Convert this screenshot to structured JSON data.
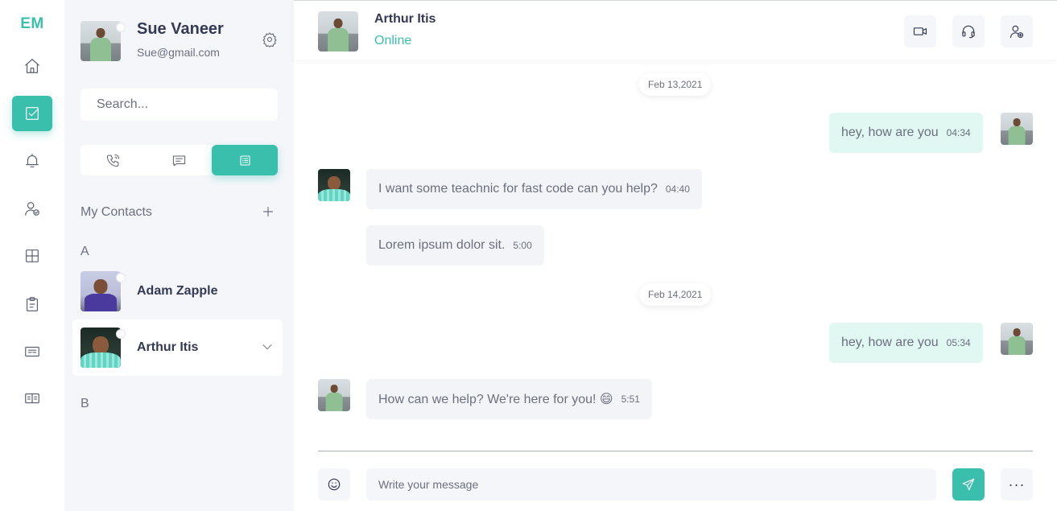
{
  "app": {
    "logo": "EM",
    "accent_color": "#3bbfad"
  },
  "rail": {
    "items": [
      {
        "icon": "home-icon",
        "active": false
      },
      {
        "icon": "checkbox-icon",
        "active": true
      },
      {
        "icon": "bell-icon",
        "active": false
      },
      {
        "icon": "user-check-icon",
        "active": false
      },
      {
        "icon": "grid-icon",
        "active": false
      },
      {
        "icon": "clipboard-icon",
        "active": false
      },
      {
        "icon": "news-icon",
        "active": false
      },
      {
        "icon": "id-card-icon",
        "active": false
      }
    ]
  },
  "profile": {
    "name": "Sue Vaneer",
    "email": "Sue@gmail.com"
  },
  "search": {
    "placeholder": "Search..."
  },
  "tabs": [
    {
      "icon": "phone-call-icon",
      "active": false
    },
    {
      "icon": "chat-icon",
      "active": false
    },
    {
      "icon": "contacts-list-icon",
      "active": true
    }
  ],
  "contacts": {
    "title": "My Contacts",
    "groups": [
      {
        "letter": "A",
        "items": [
          {
            "name": "Adam Zapple",
            "selected": false
          },
          {
            "name": "Arthur Itis",
            "selected": true
          }
        ]
      },
      {
        "letter": "B",
        "items": []
      }
    ]
  },
  "chat": {
    "header": {
      "name": "Arthur Itis",
      "status": "Online",
      "status_color": "#3bbfad"
    },
    "messages": [
      {
        "type": "date",
        "text": "Feb 13,2021"
      },
      {
        "type": "out",
        "text": "hey, how are you",
        "time": "04:34"
      },
      {
        "type": "in",
        "text": "I want some teachnic for fast code can you help?",
        "time": "04:40"
      },
      {
        "type": "in",
        "text": "Lorem ipsum dolor sit.",
        "time": "5:00"
      },
      {
        "type": "date",
        "text": "Feb 14,2021"
      },
      {
        "type": "out",
        "text": "hey, how are you",
        "time": "05:34"
      },
      {
        "type": "in",
        "text": "How can we help? We're here for you! 😄",
        "time": "5:51"
      }
    ],
    "composer": {
      "placeholder": "Write your message",
      "more_label": "···"
    }
  }
}
